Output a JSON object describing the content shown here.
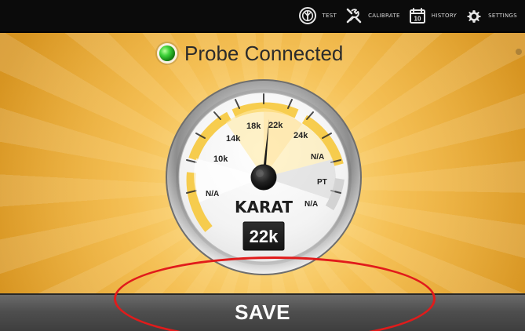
{
  "topbar": {
    "items": [
      {
        "label": "TEST",
        "icon": "probe-icon"
      },
      {
        "label": "CALIBRATE",
        "icon": "tools-icon"
      },
      {
        "label": "HISTORY",
        "icon": "calendar-icon",
        "calendar_day": "10"
      },
      {
        "label": "SETTINGS",
        "icon": "gear-icon"
      }
    ]
  },
  "status": {
    "text": "Probe Connected",
    "color": "#3fd33a"
  },
  "gauge": {
    "labels": [
      "N/A",
      "10k",
      "14k",
      "18k",
      "22k",
      "24k",
      "N/A",
      "PT",
      "N/A"
    ],
    "title": "KARAT",
    "value": "22k"
  },
  "footer": {
    "save_label": "SAVE"
  },
  "colors": {
    "accent": "#f2b53a",
    "highlight": "#e11b1b",
    "bar": "#0b0b0b"
  }
}
